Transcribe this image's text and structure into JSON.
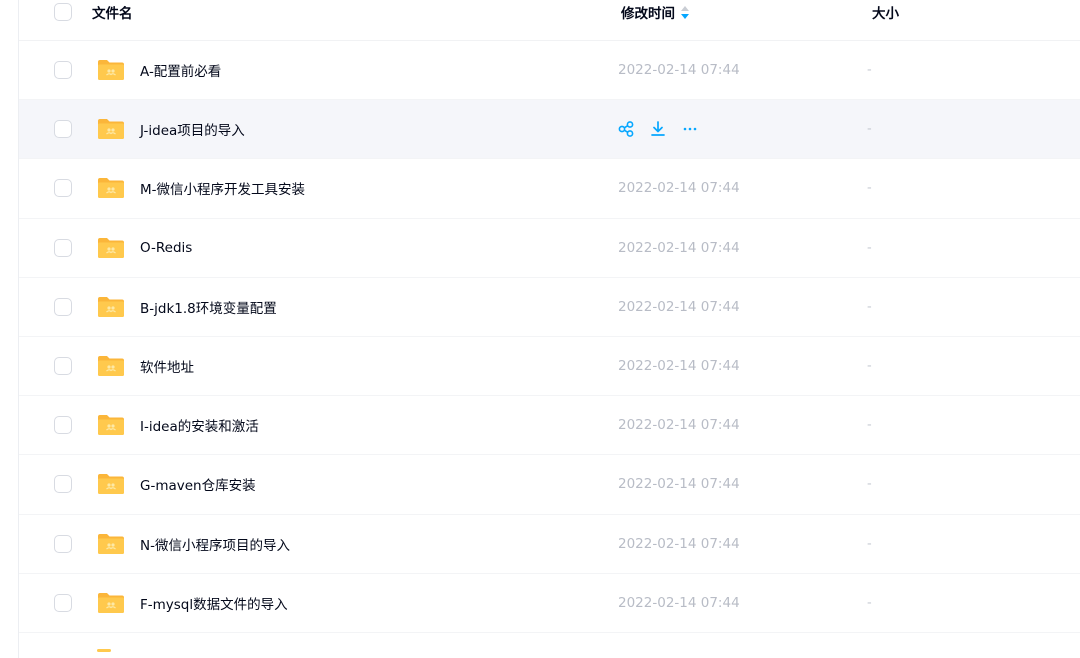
{
  "header": {
    "name_label": "文件名",
    "time_label": "修改时间",
    "size_label": "大小"
  },
  "files": [
    {
      "name": "A-配置前必看",
      "time": "2022-02-14 07:44",
      "size": "-"
    },
    {
      "name": "J-idea项目的导入",
      "time": "2022-02-14 07:44",
      "size": "-"
    },
    {
      "name": "M-微信小程序开发工具安装",
      "time": "2022-02-14 07:44",
      "size": "-"
    },
    {
      "name": "O-Redis",
      "time": "2022-02-14 07:44",
      "size": "-"
    },
    {
      "name": "B-jdk1.8环境变量配置",
      "time": "2022-02-14 07:44",
      "size": "-"
    },
    {
      "name": "软件地址",
      "time": "2022-02-14 07:44",
      "size": "-"
    },
    {
      "name": "I-idea的安装和激活",
      "time": "2022-02-14 07:44",
      "size": "-"
    },
    {
      "name": "G-maven仓库安装",
      "time": "2022-02-14 07:44",
      "size": "-"
    },
    {
      "name": "N-微信小程序项目的导入",
      "time": "2022-02-14 07:44",
      "size": "-"
    },
    {
      "name": "F-mysql数据文件的导入",
      "time": "2022-02-14 07:44",
      "size": "-"
    }
  ],
  "hovered_row_index": 1,
  "row_actions": [
    "share-icon",
    "download-icon",
    "more-icon"
  ],
  "colors": {
    "accent": "#06a7ff",
    "folder": "#ffc94d",
    "folder_back": "#fbb63a",
    "muted_text": "#b8bcc6",
    "hover_bg": "#f5f6fa"
  }
}
